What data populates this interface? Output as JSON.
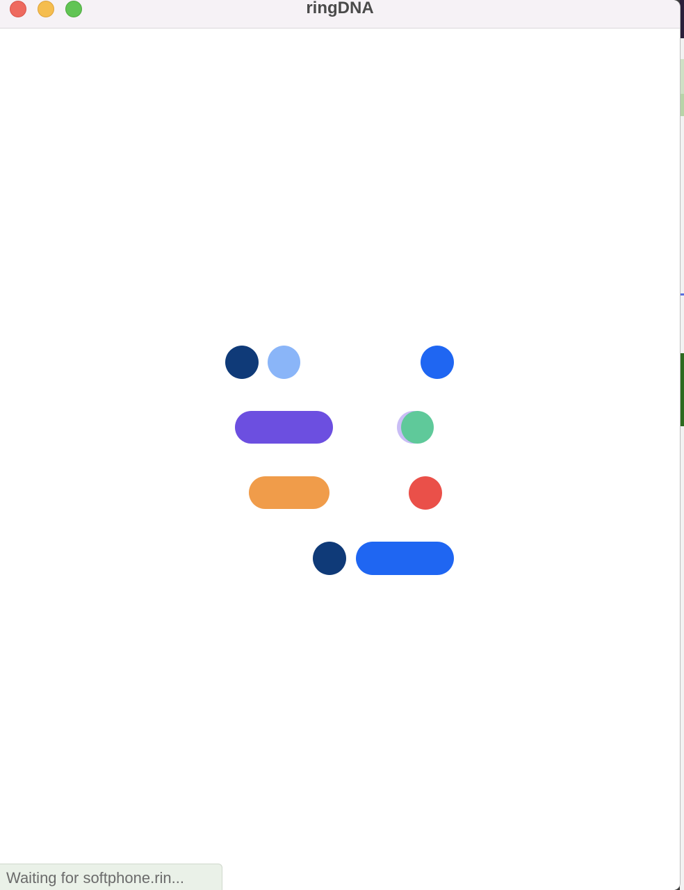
{
  "window": {
    "title": "ringDNA"
  },
  "titlebar": {
    "close_icon": "close-icon",
    "minimize_icon": "minimize-icon",
    "zoom_icon": "zoom-icon"
  },
  "loader": {
    "icon": "loading-animation",
    "colors": {
      "navy": "#0f3a78",
      "light_blue": "#8ab5f8",
      "blue": "#1f66f2",
      "purple": "#6c4fe0",
      "green": "#5fc99a",
      "orange": "#f09c4a",
      "red": "#ea5049"
    }
  },
  "status_bar": {
    "text": "Waiting for softphone.rin..."
  }
}
